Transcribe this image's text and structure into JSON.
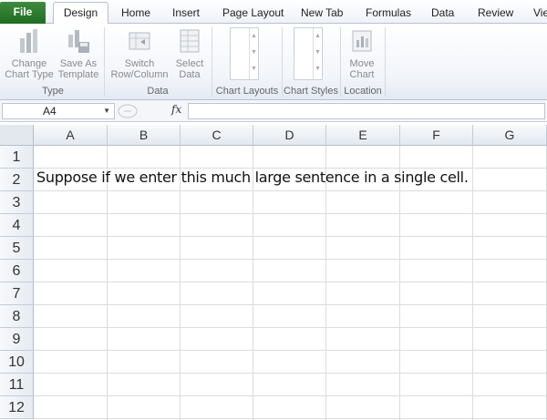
{
  "ribbon_tabs": {
    "file": "File",
    "design": "Design",
    "home": "Home",
    "insert": "Insert",
    "page_layout": "Page Layout",
    "new_tab": "New Tab",
    "formulas": "Formulas",
    "data": "Data",
    "review": "Review",
    "view": "Vie"
  },
  "ribbon": {
    "change_chart_type": [
      "Change",
      "Chart Type"
    ],
    "save_as_template": [
      "Save As",
      "Template"
    ],
    "switch_row_column": [
      "Switch",
      "Row/Column"
    ],
    "select_data": [
      "Select",
      "Data"
    ],
    "move_chart": [
      "Move",
      "Chart"
    ],
    "groups": {
      "type": "Type",
      "data": "Data",
      "chart_layouts": "Chart Layouts",
      "chart_styles": "Chart Styles",
      "location": "Location"
    }
  },
  "formula_bar": {
    "name_box": "A4",
    "fx": "fx",
    "formula": ""
  },
  "sheet": {
    "columns": [
      "A",
      "B",
      "C",
      "D",
      "E",
      "F",
      "G"
    ],
    "rows": [
      "1",
      "2",
      "3",
      "4",
      "5",
      "6",
      "7",
      "8",
      "9",
      "10",
      "11",
      "12"
    ],
    "cell_a2": "Suppose if we enter this much large sentence in a single cell."
  },
  "colors": {
    "file_tab": "#2a7a2d",
    "gridline": "#dadcdd",
    "header_bg": "#e3e8ef"
  }
}
